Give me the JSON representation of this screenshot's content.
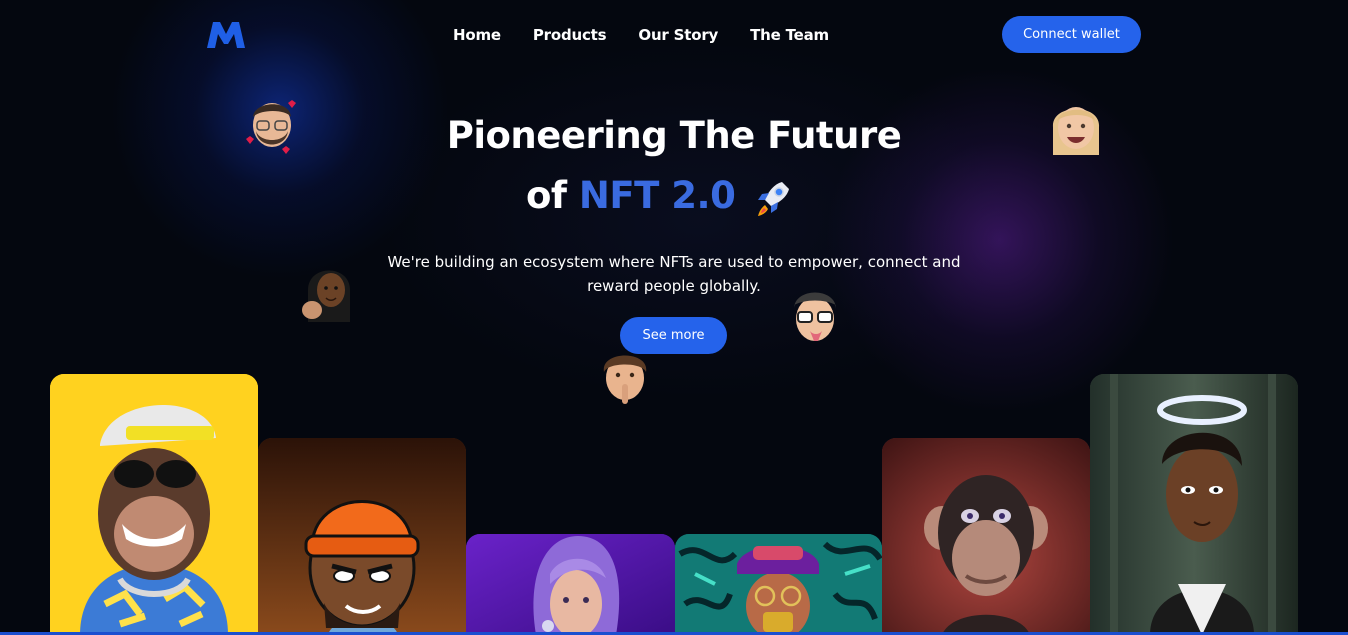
{
  "brand": {
    "logo_icon": "m-logo-icon",
    "accent": "#2563eb"
  },
  "nav": {
    "items": [
      {
        "label": "Home"
      },
      {
        "label": "Products"
      },
      {
        "label": "Our Story"
      },
      {
        "label": "The Team"
      }
    ],
    "connect_wallet_label": "Connect wallet"
  },
  "hero": {
    "title_line1": "Pioneering The Future",
    "title_line2_prefix": "of",
    "title_line2_accent": "NFT 2.0",
    "subtitle": "We're building an ecosystem where NFTs are used to empower, connect and reward people globally.",
    "see_more_label": "See more"
  },
  "colors": {
    "background": "#04070f",
    "button": "#2563eb",
    "accent_text": "#3a6be0"
  }
}
